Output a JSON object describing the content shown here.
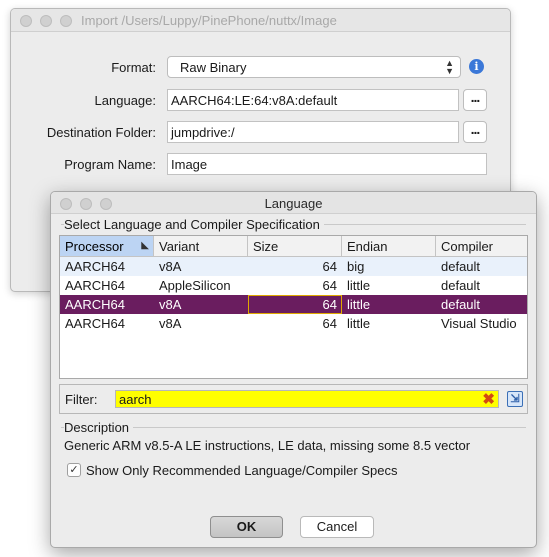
{
  "import_window": {
    "title": "Import /Users/Luppy/PinePhone/nuttx/Image",
    "format_label": "Format:",
    "format_value": "Raw Binary",
    "language_label": "Language:",
    "language_value": "AARCH64:LE:64:v8A:default",
    "destination_label": "Destination Folder:",
    "destination_value": "jumpdrive:/",
    "program_name_label": "Program Name:",
    "program_name_value": "Image",
    "browse_label": "..."
  },
  "language_dialog": {
    "title": "Language",
    "group_title": "Select Language and Compiler Specification",
    "columns": [
      "Processor",
      "Variant",
      "Size",
      "Endian",
      "Compiler"
    ],
    "rows": [
      {
        "processor": "AARCH64",
        "variant": "v8A",
        "size": "64",
        "endian": "big",
        "compiler": "default"
      },
      {
        "processor": "AARCH64",
        "variant": "AppleSilicon",
        "size": "64",
        "endian": "little",
        "compiler": "default"
      },
      {
        "processor": "AARCH64",
        "variant": "v8A",
        "size": "64",
        "endian": "little",
        "compiler": "default"
      },
      {
        "processor": "AARCH64",
        "variant": "v8A",
        "size": "64",
        "endian": "little",
        "compiler": "Visual Studio"
      }
    ],
    "selected_row_index": 2,
    "filter_label": "Filter:",
    "filter_value": "aarch",
    "description_title": "Description",
    "description_text": "Generic ARM v8.5-A LE instructions, LE data, missing some 8.5 vector",
    "checkbox_label": "Show Only Recommended Language/Compiler Specs",
    "checkbox_checked": true,
    "ok_label": "OK",
    "cancel_label": "Cancel"
  },
  "colors": {
    "selected_row": "#6a1d5f",
    "filter_highlight": "#ffff00",
    "sorted_header": "#bcd4f3"
  }
}
